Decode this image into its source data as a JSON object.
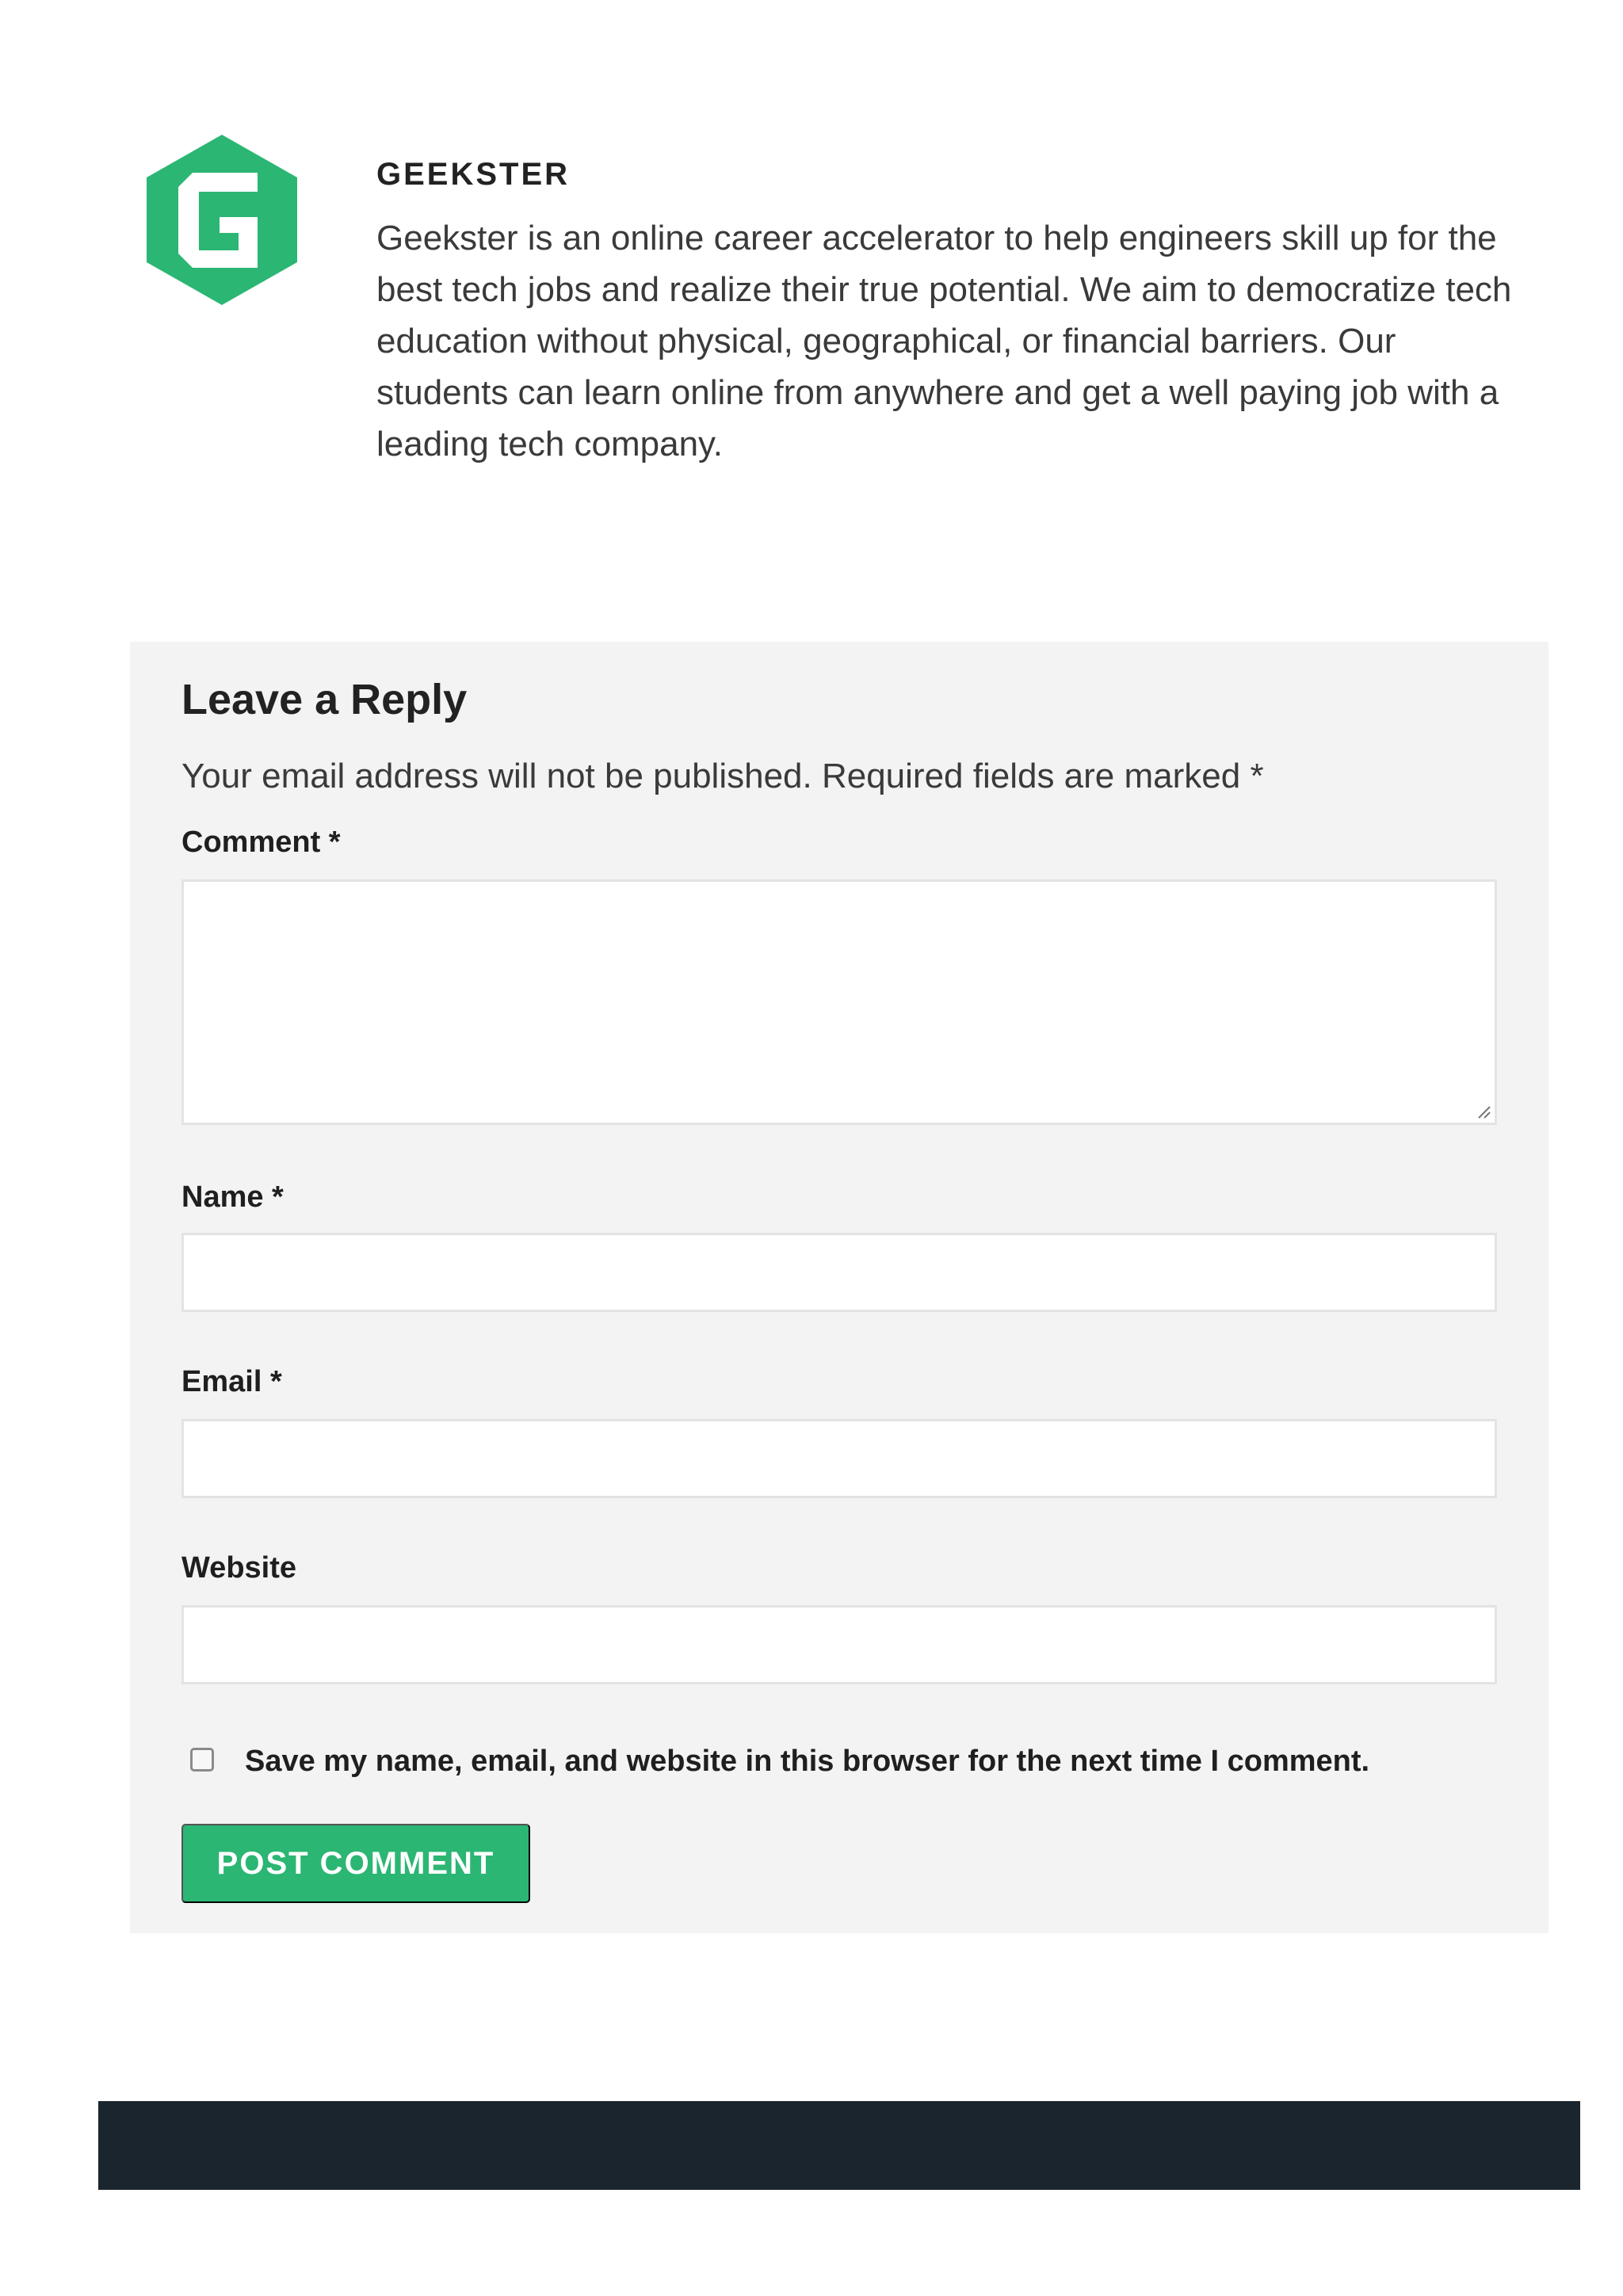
{
  "author": {
    "logo_icon": "geekster-hexagon-g-logo",
    "brand_color": "#2bb673",
    "name": "GEEKSTER",
    "bio": "Geekster is an online career accelerator to help engineers skill up for the best tech jobs and realize their true potential. We aim to democratize tech education without physical, geographical, or financial barriers. Our students can learn online from anywhere and get a well paying job with a leading tech company."
  },
  "reply": {
    "title": "Leave a Reply",
    "notes": "Your email address will not be published. Required fields are marked *",
    "comment_label": "Comment *",
    "comment_value": "",
    "name_label": "Name *",
    "name_value": "",
    "email_label": "Email *",
    "email_value": "",
    "website_label": "Website",
    "website_value": "",
    "consent_label": "Save my name, email, and website in this browser for the next time I comment.",
    "consent_checked": false,
    "submit_label": "POST COMMENT"
  },
  "colors": {
    "panel_bg": "#f3f3f3",
    "button_bg": "#2bb673",
    "footer_bg": "#1b252d"
  }
}
